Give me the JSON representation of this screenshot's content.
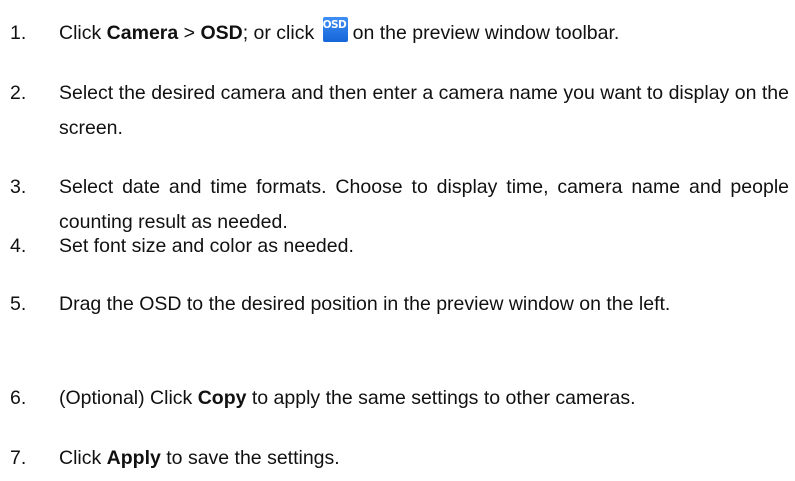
{
  "steps": [
    {
      "number": "1.",
      "before_camera": "Click ",
      "camera_label": "Camera",
      "separator": " > ",
      "osd_label": "OSD",
      "or_click": "; or click ",
      "icon_text": "OSD",
      "after_icon": "on the preview window toolbar."
    },
    {
      "number": "2.",
      "text": "Select the desired camera and then enter a camera name you want to display on the screen."
    },
    {
      "number": "3.",
      "text": "Select date and time formats. Choose to display time, camera name and people counting result as needed."
    },
    {
      "number": "4.",
      "text": "Set font size and color as needed."
    },
    {
      "number": "5.",
      "text": "Drag the OSD to the desired position in the preview window on the left."
    },
    {
      "number": "6.",
      "before": "(Optional) Click ",
      "bold": "Copy",
      "after": " to apply the same settings to other cameras."
    },
    {
      "number": "7.",
      "before": "Click ",
      "bold": "Apply",
      "after": " to save the settings."
    }
  ],
  "icons": {
    "osd_toolbar_icon": "osd-icon",
    "osd_icon_color": "#1a6fe0"
  }
}
